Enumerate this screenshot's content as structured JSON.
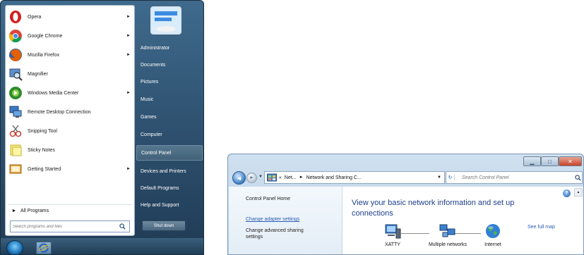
{
  "start_menu": {
    "programs": [
      {
        "label": "Opera",
        "icon": "opera-icon",
        "has_submenu": true
      },
      {
        "label": "Google Chrome",
        "icon": "chrome-icon",
        "has_submenu": true
      },
      {
        "label": "Mozilla Firefox",
        "icon": "firefox-icon",
        "has_submenu": true
      },
      {
        "label": "Magnifier",
        "icon": "magnifier-icon",
        "has_submenu": false
      },
      {
        "label": "Windows Media Center",
        "icon": "media-center-icon",
        "has_submenu": true
      },
      {
        "label": "Remote Desktop Connection",
        "icon": "remote-desktop-icon",
        "has_submenu": false
      },
      {
        "label": "Snipping Tool",
        "icon": "snipping-tool-icon",
        "has_submenu": false
      },
      {
        "label": "Sticky Notes",
        "icon": "sticky-notes-icon",
        "has_submenu": false
      },
      {
        "label": "Getting Started",
        "icon": "getting-started-icon",
        "has_submenu": true
      }
    ],
    "all_programs": "All Programs",
    "search_placeholder": "Search programs and files",
    "right_items": [
      {
        "label": "Administrator"
      },
      {
        "label": "Documents"
      },
      {
        "label": "Pictures"
      },
      {
        "label": "Music"
      },
      {
        "label": "Games"
      },
      {
        "label": "Computer"
      },
      {
        "label": "Control Panel",
        "highlighted": true
      },
      {
        "label": "Devices and Printers"
      },
      {
        "label": "Default Programs"
      },
      {
        "label": "Help and Support"
      }
    ],
    "shutdown_label": "Shut down"
  },
  "network_window": {
    "breadcrumb": {
      "overflow": "«",
      "parent": "Net...",
      "current": "Network and Sharing C..."
    },
    "search_placeholder": "Search Control Panel",
    "nav": {
      "home": "Control Panel Home",
      "adapter": "Change adapter settings",
      "advanced_line1": "Change advanced sharing",
      "advanced_line2": "settings"
    },
    "title_line1": "View your basic network information and set up",
    "title_line2": "connections",
    "see_full_map": "See full map",
    "map_nodes": [
      {
        "label": "XATTY",
        "icon": "computer-icon"
      },
      {
        "label": "Multiple networks",
        "icon": "network-icon"
      },
      {
        "label": "Internet",
        "icon": "globe-icon"
      }
    ]
  },
  "colors": {
    "start_menu_blue": "#2d4f6d",
    "link_blue": "#2a5db0",
    "heading_blue": "#1e3f8c",
    "close_red": "#c7432a"
  }
}
